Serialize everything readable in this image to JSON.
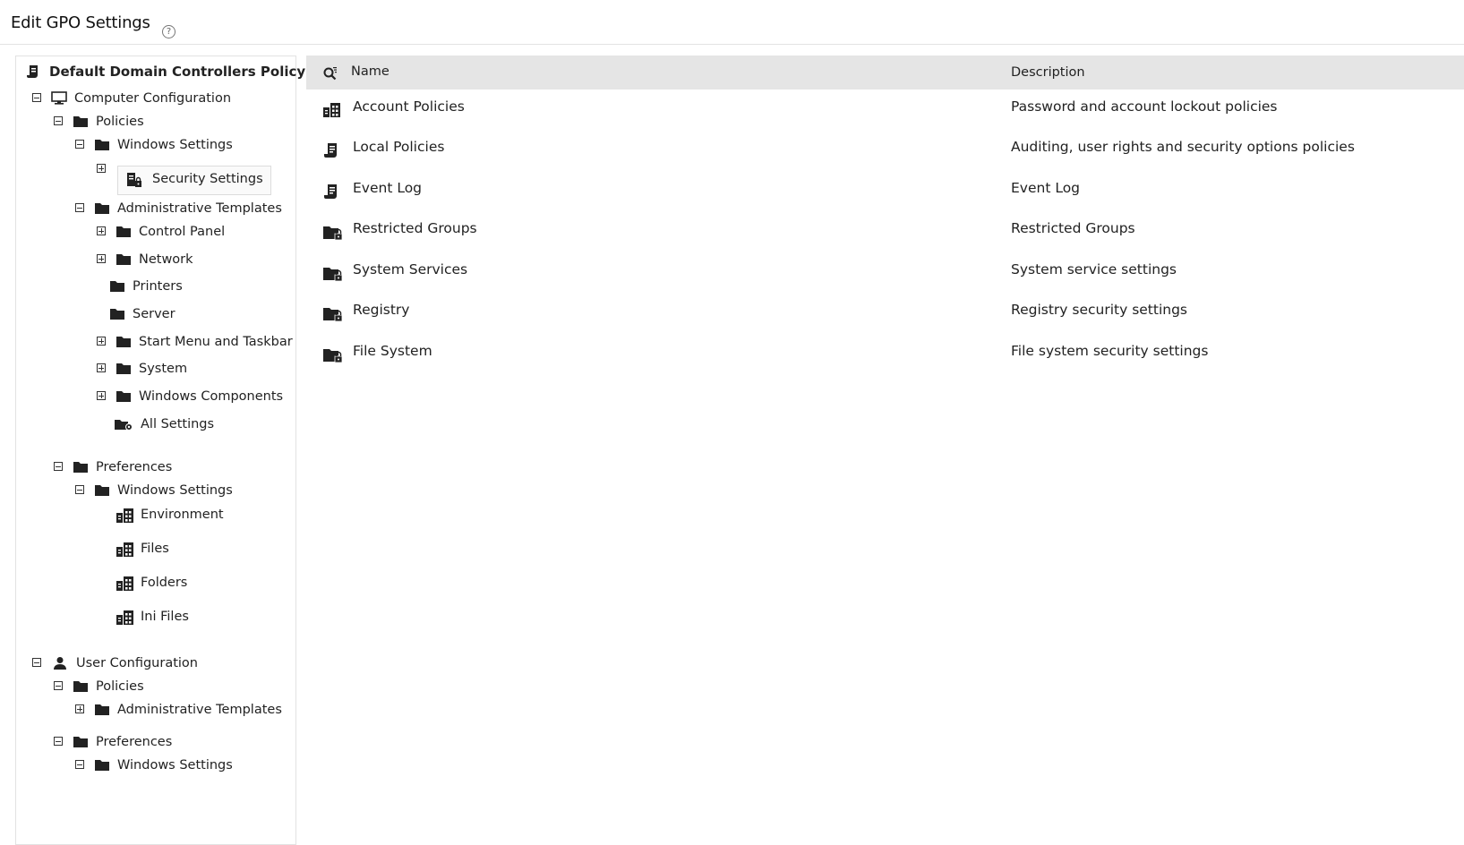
{
  "header": {
    "title": "Edit GPO Settings",
    "help_glyph": "?"
  },
  "tree": {
    "root": "Default Domain Controllers Policy",
    "nodes": {
      "computer_config": "Computer Configuration",
      "cc_policies": "Policies",
      "cc_policies_windows_settings": "Windows Settings",
      "security_settings": "Security Settings",
      "admin_templates": "Administrative Templates",
      "control_panel": "Control Panel",
      "network": "Network",
      "printers": "Printers",
      "server": "Server",
      "start_menu": "Start Menu and Taskbar",
      "system": "System",
      "windows_components": "Windows Components",
      "all_settings": "All Settings",
      "cc_preferences": "Preferences",
      "cc_pref_windows_settings": "Windows Settings",
      "environment": "Environment",
      "files": "Files",
      "folders": "Folders",
      "ini_files": "Ini Files",
      "user_config": "User Configuration",
      "uc_policies": "Policies",
      "uc_admin_templates": "Administrative Templates",
      "uc_preferences": "Preferences",
      "uc_pref_windows_settings": "Windows Settings"
    }
  },
  "list": {
    "columns": {
      "name": "Name",
      "description": "Description"
    },
    "rows": [
      {
        "name": "Account Policies",
        "description": "Password and account lockout policies",
        "icon": "policy-grid-icon"
      },
      {
        "name": "Local Policies",
        "description": "Auditing, user rights and security options policies",
        "icon": "policy-doc-icon"
      },
      {
        "name": "Event Log",
        "description": "Event Log",
        "icon": "policy-doc-icon"
      },
      {
        "name": "Restricted Groups",
        "description": "Restricted Groups",
        "icon": "folder-lock-icon"
      },
      {
        "name": "System Services",
        "description": "System service settings",
        "icon": "folder-lock-icon"
      },
      {
        "name": "Registry",
        "description": "Registry security settings",
        "icon": "folder-lock-icon"
      },
      {
        "name": "File System",
        "description": "File system security settings",
        "icon": "folder-lock-icon"
      }
    ]
  }
}
